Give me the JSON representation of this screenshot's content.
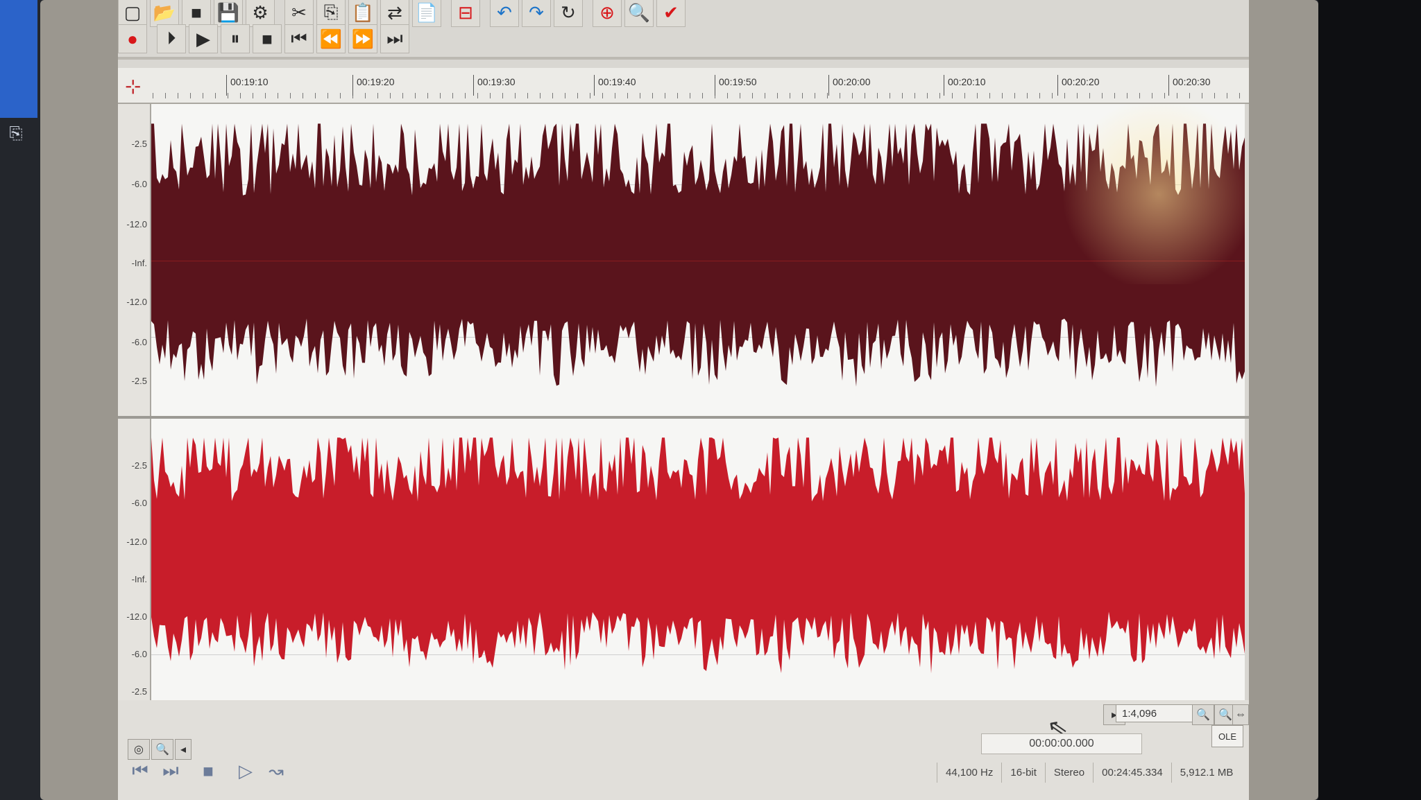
{
  "ruler": {
    "ticks": [
      "00:19:10",
      "00:19:20",
      "00:19:30",
      "00:19:40",
      "00:19:50",
      "00:20:00",
      "00:20:10",
      "00:20:20",
      "00:20:30"
    ]
  },
  "db_scale": {
    "top_channel": [
      "-2.5",
      "-6.0",
      "-12.0",
      "-Inf.",
      "-12.0",
      "-6.0",
      "-2.5"
    ],
    "bottom_channel": [
      "-2.5",
      "-6.0",
      "-12.0",
      "-Inf.",
      "-12.0",
      "-6.0",
      "-2.5"
    ]
  },
  "waveform": {
    "top_color": "#5a141c",
    "bottom_color": "#c81d2a"
  },
  "bottom_bar": {
    "zoom_ratio": "1:4,096",
    "ole_label": "OLE",
    "cursor_time": "00:00:00.000",
    "status": {
      "sample_rate": "44,100 Hz",
      "bit_depth": "16-bit",
      "channels": "Stereo",
      "length": "00:24:45.334",
      "file_size": "5,912.1 MB"
    }
  },
  "icons": {
    "toolbar1": [
      "new-icon",
      "open-icon",
      "stop-square-icon",
      "save-icon",
      "properties-icon",
      "cut-icon",
      "copy-icon",
      "paste-icon",
      "mix-icon",
      "paste-new-icon",
      "trim-icon",
      "undo-icon",
      "redo-icon",
      "repeat-icon",
      "marker-icon",
      "zoom-icon",
      "check-icon"
    ],
    "toolbar2": [
      "record-icon",
      "play-all-icon",
      "play-icon",
      "pause-icon",
      "stop-icon",
      "go-start-icon",
      "rewind-icon",
      "fast-forward-icon",
      "go-end-icon"
    ]
  }
}
